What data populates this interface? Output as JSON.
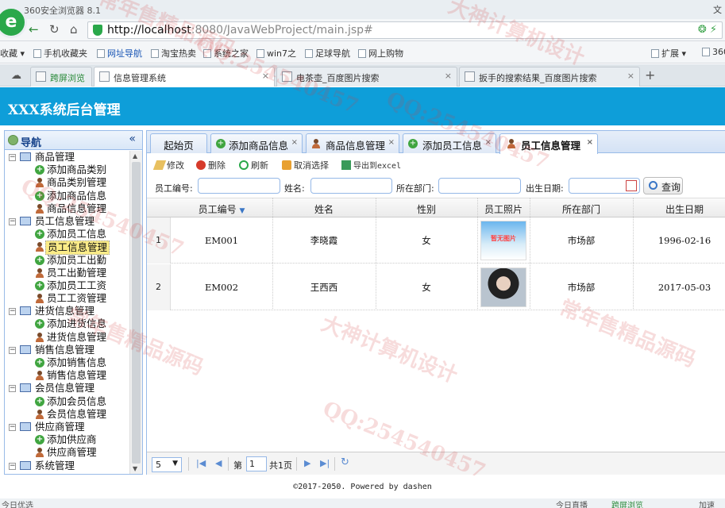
{
  "browser": {
    "name": "360安全浏览器 8.1",
    "title_right": "文",
    "url_host": "http://localhost",
    "url_rest": ":8080/JavaWebProject/main.jsp#",
    "favorites": [
      "收藏",
      "手机收藏夹",
      "网址导航",
      "淘宝热卖",
      "系统之家",
      "win7之",
      "足球导航",
      "网上购物",
      "扩展",
      "360"
    ],
    "tabs": [
      "跨屏浏览",
      "信息管理系统",
      "电茶壶_百度图片搜索",
      "扳手的搜索结果_百度图片搜索"
    ],
    "status_left": "今日优选",
    "status_right": [
      "今日直播",
      "跨屏浏览",
      "加速"
    ]
  },
  "app": {
    "title": "XXX系统后台管理",
    "footer": "©2017-2050. Powered by dashen"
  },
  "sidebar": {
    "title": "导航",
    "collapse": "«",
    "tree": [
      {
        "label": "商品管理",
        "type": "group"
      },
      {
        "label": "添加商品类别",
        "type": "add"
      },
      {
        "label": "商品类别管理",
        "type": "user"
      },
      {
        "label": "添加商品信息",
        "type": "add"
      },
      {
        "label": "商品信息管理",
        "type": "user"
      },
      {
        "label": "员工信息管理",
        "type": "group"
      },
      {
        "label": "添加员工信息",
        "type": "add"
      },
      {
        "label": "员工信息管理",
        "type": "user",
        "selected": true
      },
      {
        "label": "添加员工出勤",
        "type": "add"
      },
      {
        "label": "员工出勤管理",
        "type": "user"
      },
      {
        "label": "添加员工工资",
        "type": "add"
      },
      {
        "label": "员工工资管理",
        "type": "user"
      },
      {
        "label": "进货信息管理",
        "type": "group"
      },
      {
        "label": "添加进货信息",
        "type": "add"
      },
      {
        "label": "进货信息管理",
        "type": "user"
      },
      {
        "label": "销售信息管理",
        "type": "group"
      },
      {
        "label": "添加销售信息",
        "type": "add"
      },
      {
        "label": "销售信息管理",
        "type": "user"
      },
      {
        "label": "会员信息管理",
        "type": "group"
      },
      {
        "label": "添加会员信息",
        "type": "add"
      },
      {
        "label": "会员信息管理",
        "type": "user"
      },
      {
        "label": "供应商管理",
        "type": "group"
      },
      {
        "label": "添加供应商",
        "type": "add"
      },
      {
        "label": "供应商管理",
        "type": "user"
      },
      {
        "label": "系统管理",
        "type": "group"
      }
    ]
  },
  "tabs": [
    "起始页",
    "添加商品信息",
    "商品信息管理",
    "添加员工信息",
    "员工信息管理"
  ],
  "toolbar": [
    "修改",
    "删除",
    "刷新",
    "取消选择",
    "导出到excel"
  ],
  "search": {
    "labels": [
      "员工编号:",
      "姓名:",
      "所在部门:",
      "出生日期:"
    ],
    "button": "查询"
  },
  "grid": {
    "headers": [
      "员工编号",
      "姓名",
      "性别",
      "员工照片",
      "所在部门",
      "出生日期"
    ],
    "rows": [
      {
        "num": "1",
        "id": "EM001",
        "name": "李晓霞",
        "sex": "女",
        "photo": "暂无图片",
        "dept": "市场部",
        "birth": "1996-02-16"
      },
      {
        "num": "2",
        "id": "EM002",
        "name": "王西西",
        "sex": "女",
        "photo": "",
        "dept": "市场部",
        "birth": "2017-05-03"
      }
    ]
  },
  "pager": {
    "page_size": "5",
    "page_prefix": "第",
    "page": "1",
    "page_total": "共1页"
  },
  "watermarks": [
    "大神计算机设计",
    "QQ:254540457",
    "常年售精品源码"
  ]
}
